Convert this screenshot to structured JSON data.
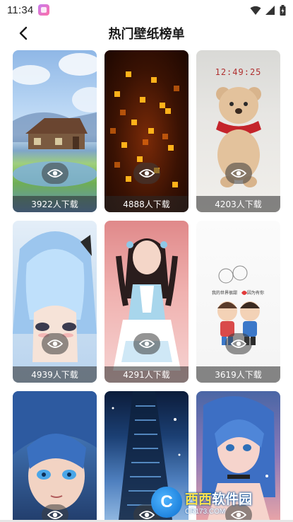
{
  "status_bar": {
    "time": "11:34"
  },
  "header": {
    "title": "热门壁纸榜单"
  },
  "wallpapers": [
    {
      "downloads": "3922人下载",
      "theme": "house-in-meadow"
    },
    {
      "downloads": "4888人下载",
      "theme": "glowing-pixel-grid"
    },
    {
      "downloads": "4203人下载",
      "theme": "teddy-bear-red-scarf",
      "clock_text": "12:49:25"
    },
    {
      "downloads": "4939人下载",
      "theme": "anime-girl-blue-hair"
    },
    {
      "downloads": "4291人下载",
      "theme": "girl-in-maid-dress"
    },
    {
      "downloads": "3619人下载",
      "theme": "cartoon-couple",
      "caption_left": "我的世界很甜",
      "caption_right": "因为有你"
    },
    {
      "downloads": "",
      "theme": "anime-girl-blue-eyes"
    },
    {
      "downloads": "",
      "theme": "night-city-tower"
    },
    {
      "downloads": "",
      "theme": "anime-girl-neon"
    }
  ],
  "watermark": {
    "logo": "C",
    "name_cn": "西西",
    "name_suffix": "软件园",
    "url": "CR173.COM"
  },
  "colors": {
    "title": "#1a1a1a",
    "overlay": "#282828"
  }
}
